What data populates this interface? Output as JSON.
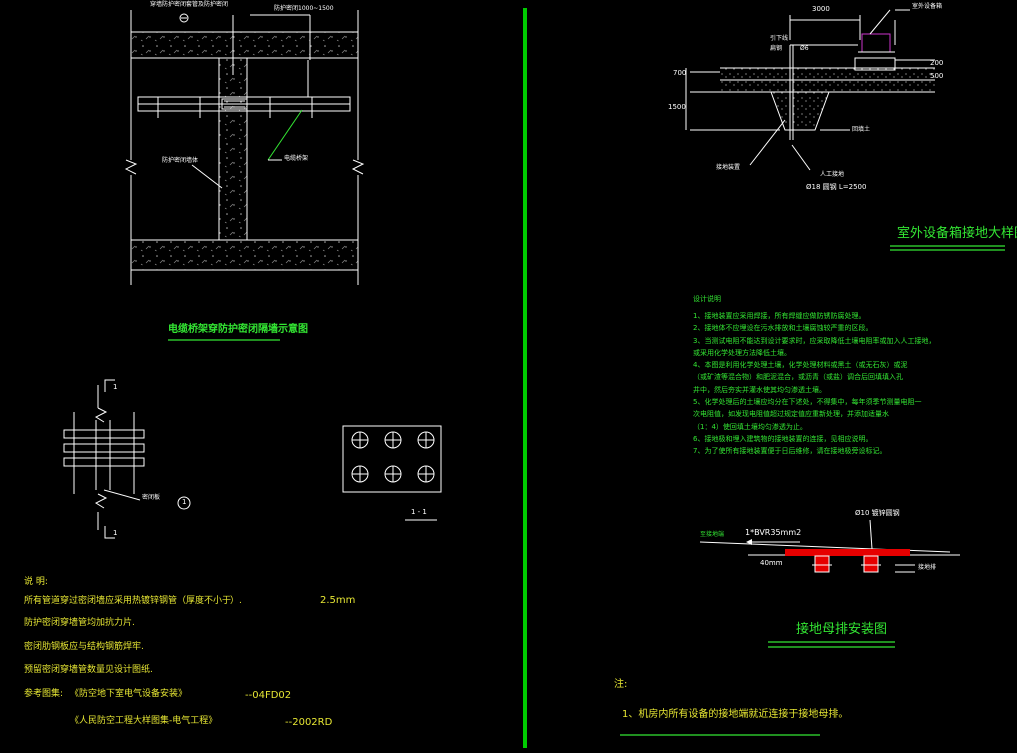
{
  "colors": {
    "background": "#000000",
    "line": "#ffffff",
    "text_green": "#33e633",
    "text_yellow": "#e6e633",
    "accent_red": "#e60000",
    "divider": "#00cc00",
    "magenta": "#cc33cc"
  },
  "left_top": {
    "label_top": "穿墙防护密闭套管及防护密闭",
    "label_dim": "防护密闭1000~1500",
    "label_wall": "防护密闭墙体",
    "label_pipe": "电缆桥架",
    "title": "电缆桥架穿防护密闭隔墙示意图"
  },
  "left_mid": {
    "marker_top": "1",
    "marker_bottom": "1",
    "label_plate": "密闭板",
    "circle_label": "1",
    "section_label": "1 - 1"
  },
  "left_notes": {
    "heading": "说 明:",
    "line1": "所有管道穿过密闭墙应采用热镀锌钢管（厚度不小于",
    "line1_tail": "）.",
    "line1_value": "2.5mm",
    "line2": "防护密闭穿墙管均加抗力片.",
    "line3": "密闭肋钢板应与结构钢筋焊牢.",
    "line4": "预留密闭穿墙管数量见设计图纸.",
    "ref_label": "参考图集:",
    "ref1": "《防空地下室电气设备安装》",
    "ref1_code": "--04FD02",
    "ref2": "《人民防空工程大样图集-电气工程》",
    "ref2_code": "--2002RD"
  },
  "right_top": {
    "dim_3000": "3000",
    "dim_700": "700",
    "dim_1500": "1500",
    "dim_200": "200",
    "dim_500": "500",
    "label_box": "室外设备箱",
    "label_a": "引下线",
    "label_b": "扁钢",
    "label_c": "Ø6",
    "label_d": "回填土",
    "label_e": "接地装置",
    "label_f": "人工接地",
    "label_spec": "Ø18   圆钢   L=2500",
    "title": "室外设备箱接地大样图"
  },
  "design_notes": {
    "heading": "设计说明",
    "items": [
      "1、接地装置应采用焊接，所有焊缝应做防锈防腐处理。",
      "2、接地体不应埋设在污水排放和土壤腐蚀较严重的区段。",
      "3、当测试电阻不能达到设计要求时，应采取降低土壤电阻率或加入人工接地，",
      "     或采用化学处理方法降低土壤。",
      "4、本图是利用化学处理土壤，化学处理材料或黑土（或无石灰）或泥",
      "     （或矿渣等混合物）和肥泥混合，或沥青（或盐）调合后回填填入孔",
      "     井中，然后夯实并灌水使其均匀渗透土壤。",
      "5、化学处理后的土壤应均分在下述处，不得集中，每年须季节测量电阻一",
      "     次电阻值，如发现电阻值超过规定值应重新处理，并添加适量水",
      "     （1：4）使回填土壤均匀渗透为止。",
      "6、接地极和埋入建筑物的接地装置的连接，见相应说明。",
      "7、为了使所有接地装置便于日后维修，请在接地极旁设标记。"
    ]
  },
  "busbar": {
    "label_left": "至接地端",
    "label_cable": "1*BVR35mm2",
    "label_bolt": "Ø10 镀锌圆钢",
    "label_40": "40mm",
    "label_right": "接地排",
    "title": "接地母排安装图"
  },
  "bottom_note": {
    "heading": "注:",
    "item1": "1、机房内所有设备的接地端就近连接于接地母排。"
  }
}
